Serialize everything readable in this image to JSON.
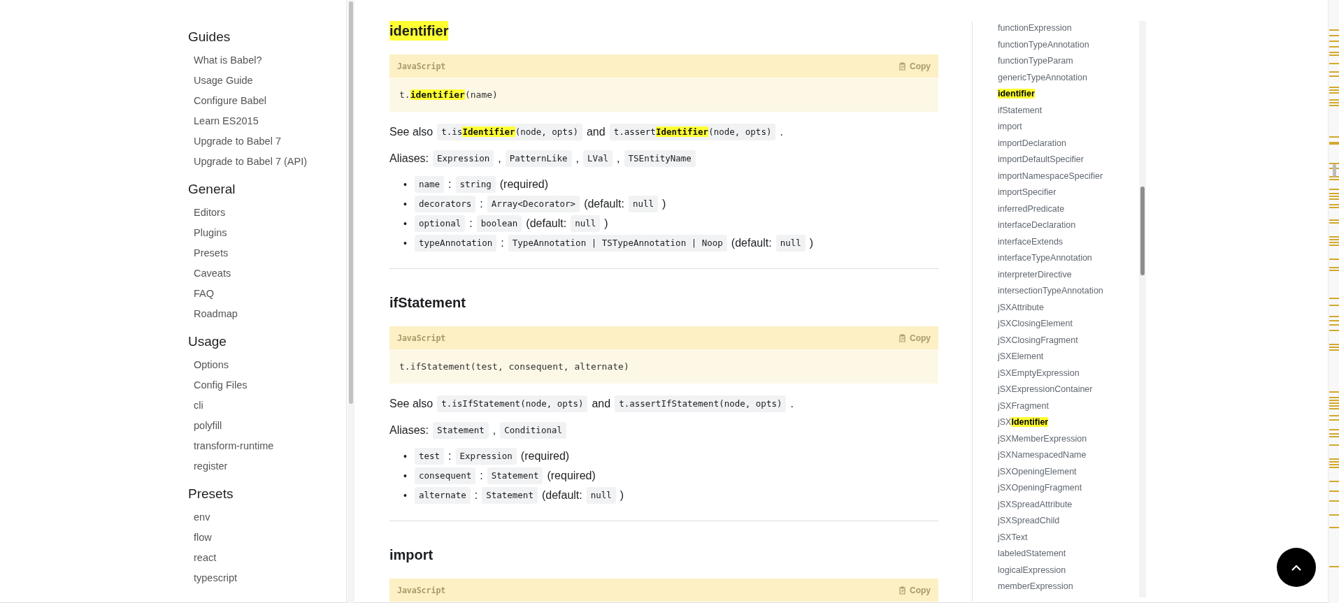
{
  "sidebar": {
    "sections": [
      {
        "title": "Guides",
        "items": [
          {
            "label": "What is Babel?"
          },
          {
            "label": "Usage Guide"
          },
          {
            "label": "Configure Babel"
          },
          {
            "label": "Learn ES2015"
          },
          {
            "label": "Upgrade to Babel 7"
          },
          {
            "label": "Upgrade to Babel 7 (API)"
          }
        ]
      },
      {
        "title": "General",
        "items": [
          {
            "label": "Editors"
          },
          {
            "label": "Plugins"
          },
          {
            "label": "Presets"
          },
          {
            "label": "Caveats"
          },
          {
            "label": "FAQ"
          },
          {
            "label": "Roadmap"
          }
        ]
      },
      {
        "title": "Usage",
        "items": [
          {
            "label": "Options"
          },
          {
            "label": "Config Files"
          },
          {
            "label": "cli"
          },
          {
            "label": "polyfill"
          },
          {
            "label": "transform-runtime"
          },
          {
            "label": "register"
          }
        ]
      },
      {
        "title": "Presets",
        "items": [
          {
            "label": "env"
          },
          {
            "label": "flow"
          },
          {
            "label": "react"
          },
          {
            "label": "typescript"
          }
        ]
      }
    ]
  },
  "sections": [
    {
      "title": "identifier",
      "highlighted": true,
      "code_block": {
        "language": "JavaScript",
        "copy": "Copy",
        "code": "t.**identifier**(name)"
      },
      "see_also": [
        {
          "kind": "text",
          "text": "See also"
        },
        {
          "kind": "code",
          "text": "t.is**Identifier**(node, opts)"
        },
        {
          "kind": "text",
          "text": "and"
        },
        {
          "kind": "code",
          "text": "t.assert**Identifier**(node, opts)"
        },
        {
          "kind": "text",
          "text": "."
        }
      ],
      "aliases": [
        {
          "kind": "text",
          "text": "Aliases:"
        },
        {
          "kind": "code",
          "text": "Expression"
        },
        {
          "kind": "text",
          "text": ","
        },
        {
          "kind": "code",
          "text": "PatternLike"
        },
        {
          "kind": "text",
          "text": ","
        },
        {
          "kind": "code",
          "text": "LVal"
        },
        {
          "kind": "text",
          "text": ","
        },
        {
          "kind": "code",
          "text": "TSEntityName"
        }
      ],
      "params": [
        {
          "bullet": "•",
          "parts": [
            {
              "kind": "code",
              "text": "name"
            },
            {
              "kind": "text",
              "text": ":"
            },
            {
              "kind": "code",
              "text": "string"
            },
            {
              "kind": "text",
              "text": "(required)"
            }
          ]
        },
        {
          "bullet": "•",
          "parts": [
            {
              "kind": "code",
              "text": "decorators"
            },
            {
              "kind": "text",
              "text": ":"
            },
            {
              "kind": "code",
              "text": "Array<Decorator>"
            },
            {
              "kind": "text",
              "text": "(default:"
            },
            {
              "kind": "code",
              "text": "null"
            },
            {
              "kind": "text",
              "text": ")"
            }
          ]
        },
        {
          "bullet": "•",
          "parts": [
            {
              "kind": "code",
              "text": "optional"
            },
            {
              "kind": "text",
              "text": ":"
            },
            {
              "kind": "code",
              "text": "boolean"
            },
            {
              "kind": "text",
              "text": "(default:"
            },
            {
              "kind": "code",
              "text": "null"
            },
            {
              "kind": "text",
              "text": ")"
            }
          ]
        },
        {
          "bullet": "•",
          "parts": [
            {
              "kind": "code",
              "text": "typeAnnotation"
            },
            {
              "kind": "text",
              "text": ":"
            },
            {
              "kind": "code",
              "text": "TypeAnnotation | TSTypeAnnotation | Noop"
            },
            {
              "kind": "text",
              "text": "(default:"
            },
            {
              "kind": "code",
              "text": "null"
            },
            {
              "kind": "text",
              "text": ")"
            }
          ]
        }
      ]
    },
    {
      "title": "ifStatement",
      "highlighted": false,
      "code_block": {
        "language": "JavaScript",
        "copy": "Copy",
        "code": "t.ifStatement(test, consequent, alternate)"
      },
      "see_also": [
        {
          "kind": "text",
          "text": "See also"
        },
        {
          "kind": "code",
          "text": "t.isIfStatement(node, opts)"
        },
        {
          "kind": "text",
          "text": "and"
        },
        {
          "kind": "code",
          "text": "t.assertIfStatement(node, opts)"
        },
        {
          "kind": "text",
          "text": "."
        }
      ],
      "aliases": [
        {
          "kind": "text",
          "text": "Aliases:"
        },
        {
          "kind": "code",
          "text": "Statement"
        },
        {
          "kind": "text",
          "text": ","
        },
        {
          "kind": "code",
          "text": "Conditional"
        }
      ],
      "params": [
        {
          "bullet": "•",
          "parts": [
            {
              "kind": "code",
              "text": "test"
            },
            {
              "kind": "text",
              "text": ":"
            },
            {
              "kind": "code",
              "text": "Expression"
            },
            {
              "kind": "text",
              "text": "(required)"
            }
          ]
        },
        {
          "bullet": "•",
          "parts": [
            {
              "kind": "code",
              "text": "consequent"
            },
            {
              "kind": "text",
              "text": ":"
            },
            {
              "kind": "code",
              "text": "Statement"
            },
            {
              "kind": "text",
              "text": "(required)"
            }
          ]
        },
        {
          "bullet": "•",
          "parts": [
            {
              "kind": "code",
              "text": "alternate"
            },
            {
              "kind": "text",
              "text": ":"
            },
            {
              "kind": "code",
              "text": "Statement"
            },
            {
              "kind": "text",
              "text": "(default:"
            },
            {
              "kind": "code",
              "text": "null"
            },
            {
              "kind": "text",
              "text": ")"
            }
          ]
        }
      ]
    },
    {
      "title": "import",
      "highlighted": false,
      "code_block": {
        "language": "JavaScript",
        "copy": "Copy"
      }
    }
  ],
  "toc": {
    "items": [
      {
        "label": "functionExpression",
        "highlighted": false
      },
      {
        "label": "functionTypeAnnotation",
        "highlighted": false
      },
      {
        "label": "functionTypeParam",
        "highlighted": false
      },
      {
        "label": "genericTypeAnnotation",
        "highlighted": false
      },
      {
        "label": "identifier",
        "highlighted": true
      },
      {
        "label": "ifStatement",
        "highlighted": false
      },
      {
        "label": "import",
        "highlighted": false
      },
      {
        "label": "importDeclaration",
        "highlighted": false
      },
      {
        "label": "importDefaultSpecifier",
        "highlighted": false
      },
      {
        "label": "importNamespaceSpecifier",
        "highlighted": false
      },
      {
        "label": "importSpecifier",
        "highlighted": false
      },
      {
        "label": "inferredPredicate",
        "highlighted": false
      },
      {
        "label": "interfaceDeclaration",
        "highlighted": false
      },
      {
        "label": "interfaceExtends",
        "highlighted": false
      },
      {
        "label": "interfaceTypeAnnotation",
        "highlighted": false
      },
      {
        "label": "interpreterDirective",
        "highlighted": false
      },
      {
        "label": "intersectionTypeAnnotation",
        "highlighted": false
      },
      {
        "label": "jSXAttribute",
        "highlighted": false
      },
      {
        "label": "jSXClosingElement",
        "highlighted": false
      },
      {
        "label": "jSXClosingFragment",
        "highlighted": false
      },
      {
        "label": "jSXElement",
        "highlighted": false
      },
      {
        "label": "jSXEmptyExpression",
        "highlighted": false
      },
      {
        "label": "jSXExpressionContainer",
        "highlighted": false
      },
      {
        "label": "jSXFragment",
        "highlighted": false
      },
      {
        "label": "jSX**Identifier**",
        "highlighted": false
      },
      {
        "label": "jSXMemberExpression",
        "highlighted": false
      },
      {
        "label": "jSXNamespacedName",
        "highlighted": false
      },
      {
        "label": "jSXOpeningElement",
        "highlighted": false
      },
      {
        "label": "jSXOpeningFragment",
        "highlighted": false
      },
      {
        "label": "jSXSpreadAttribute",
        "highlighted": false
      },
      {
        "label": "jSXSpreadChild",
        "highlighted": false
      },
      {
        "label": "jSXText",
        "highlighted": false
      },
      {
        "label": "labeledStatement",
        "highlighted": false
      },
      {
        "label": "logicalExpression",
        "highlighted": false
      },
      {
        "label": "memberExpression",
        "highlighted": false
      }
    ]
  }
}
